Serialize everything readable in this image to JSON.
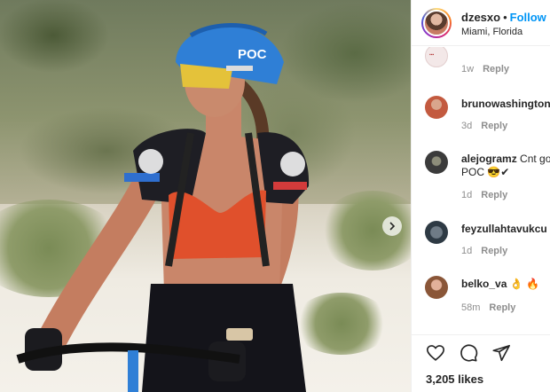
{
  "post": {
    "username": "dzesxo",
    "separator": "•",
    "follow_label": "Follow",
    "location": "Miami, Florida",
    "helmet_brand": "POC"
  },
  "comments": [
    {
      "username": "",
      "text": "",
      "time": "1w",
      "reply_label": "Reply"
    },
    {
      "username": "brunowashington",
      "text": "",
      "time": "3d",
      "reply_label": "Reply"
    },
    {
      "username": "alejogramz",
      "text": "Cnt go",
      "text_line2": "POC 😎✔",
      "time": "1d",
      "reply_label": "Reply"
    },
    {
      "username": "feyzullahtavukcu",
      "text": "",
      "time": "1d",
      "reply_label": "Reply"
    },
    {
      "username": "belko_va",
      "text": "👌 🔥",
      "time": "58m",
      "reply_label": "Reply"
    }
  ],
  "actions": {
    "like_icon": "heart-icon",
    "comment_icon": "comment-icon",
    "share_icon": "share-icon",
    "likes_text": "3,205 likes"
  },
  "icons": {
    "carousel_next": "chevron-right-icon"
  },
  "colors": {
    "follow": "#0095f6",
    "meta": "#8e8e8e",
    "text": "#262626"
  }
}
